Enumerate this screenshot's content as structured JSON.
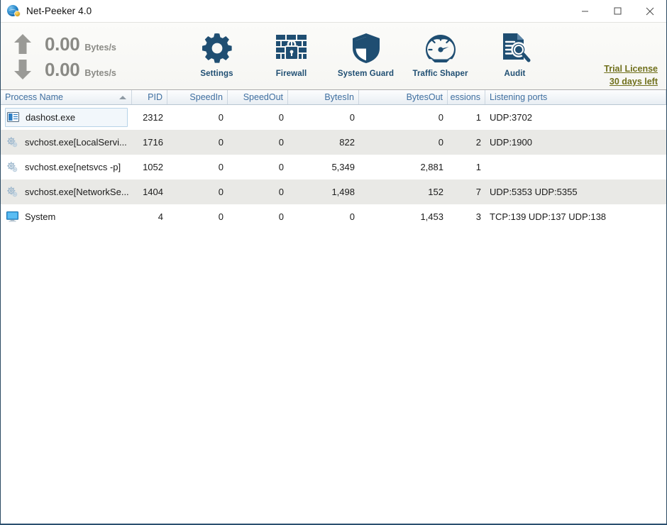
{
  "window": {
    "title": "Net-Peeker 4.0",
    "app_icon": "globe-gear-icon",
    "controls": {
      "minimize": "minimize-icon",
      "maximize": "maximize-icon",
      "close": "close-icon"
    }
  },
  "toolbar": {
    "upload": {
      "icon": "arrow-up-icon",
      "value": "0.00",
      "unit": "Bytes/s"
    },
    "download": {
      "icon": "arrow-down-icon",
      "value": "0.00",
      "unit": "Bytes/s"
    },
    "items": [
      {
        "label": "Settings",
        "icon": "gear-icon"
      },
      {
        "label": "Firewall",
        "icon": "brick-wall-lock-icon"
      },
      {
        "label": "System Guard",
        "icon": "shield-icon"
      },
      {
        "label": "Traffic Shaper",
        "icon": "speedometer-icon"
      },
      {
        "label": "Audit",
        "icon": "document-magnifier-icon"
      }
    ],
    "license": {
      "line1": "Trial License",
      "line2": "30 days left",
      "color": "#70701c"
    }
  },
  "table": {
    "sort_column": "Process Name",
    "sort_direction": "ascending",
    "columns": [
      {
        "key": "name",
        "label": "Process Name",
        "align": "left"
      },
      {
        "key": "pid",
        "label": "PID",
        "align": "right"
      },
      {
        "key": "sin",
        "label": "SpeedIn",
        "align": "right"
      },
      {
        "key": "sout",
        "label": "SpeedOut",
        "align": "right"
      },
      {
        "key": "bin",
        "label": "BytesIn",
        "align": "right"
      },
      {
        "key": "bout",
        "label": "BytesOut",
        "align": "right"
      },
      {
        "key": "sess",
        "label": "essions",
        "align": "right"
      },
      {
        "key": "ports",
        "label": "Listening ports",
        "align": "left"
      }
    ],
    "rows": [
      {
        "icon": "window-app-icon",
        "name": "dashost.exe",
        "pid": "2312",
        "sin": "0",
        "sout": "0",
        "bin": "0",
        "bout": "0",
        "sess": "1",
        "ports": "UDP:3702",
        "selected": true
      },
      {
        "icon": "service-gear-icon",
        "name": "svchost.exe[LocalServi...",
        "pid": "1716",
        "sin": "0",
        "sout": "0",
        "bin": "822",
        "bout": "0",
        "sess": "2",
        "ports": "UDP:1900",
        "selected": false
      },
      {
        "icon": "service-gear-icon",
        "name": "svchost.exe[netsvcs -p]",
        "pid": "1052",
        "sin": "0",
        "sout": "0",
        "bin": "5,349",
        "bout": "2,881",
        "sess": "1",
        "ports": "",
        "selected": false
      },
      {
        "icon": "service-gear-icon",
        "name": "svchost.exe[NetworkSe...",
        "pid": "1404",
        "sin": "0",
        "sout": "0",
        "bin": "1,498",
        "bout": "152",
        "sess": "7",
        "ports": "UDP:5353 UDP:5355",
        "selected": false
      },
      {
        "icon": "monitor-icon",
        "name": "System",
        "pid": "4",
        "sin": "0",
        "sout": "0",
        "bin": "0",
        "bout": "1,453",
        "sess": "3",
        "ports": "TCP:139 UDP:137 UDP:138",
        "selected": false
      }
    ]
  }
}
